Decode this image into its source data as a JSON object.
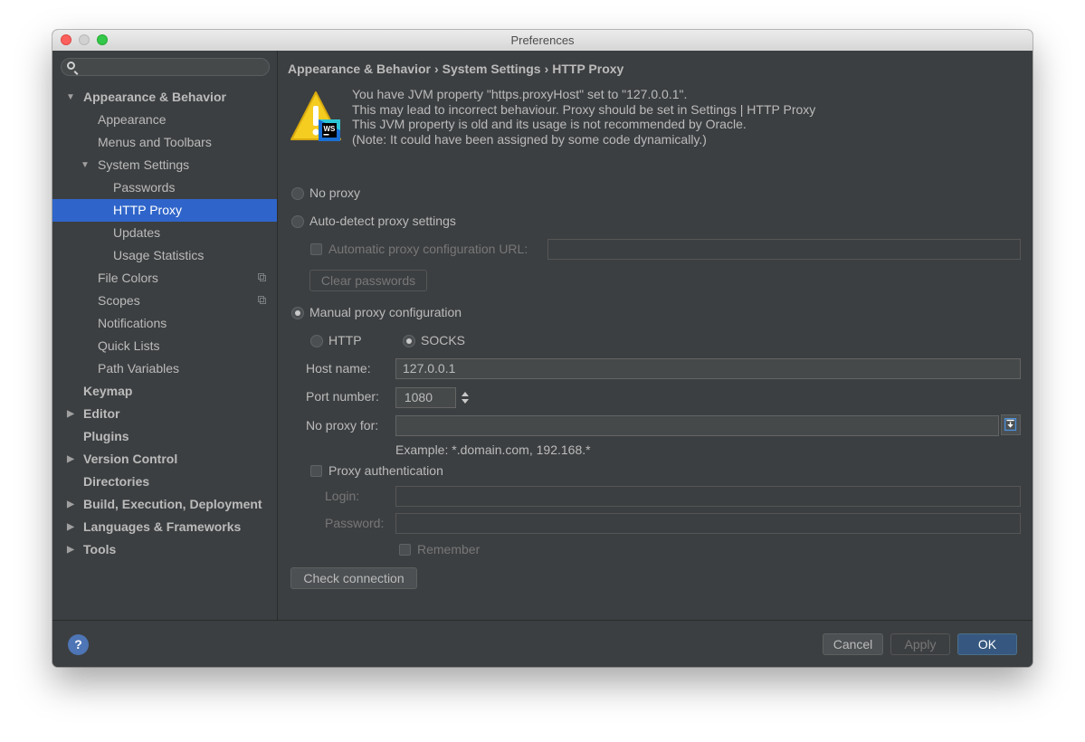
{
  "window": {
    "title": "Preferences"
  },
  "search": {
    "icon": "search-icon",
    "placeholder": ""
  },
  "sidebar": {
    "items": [
      {
        "label": "Appearance & Behavior",
        "expanded": true
      },
      {
        "label": "Appearance"
      },
      {
        "label": "Menus and Toolbars"
      },
      {
        "label": "System Settings",
        "expanded": true
      },
      {
        "label": "Passwords"
      },
      {
        "label": "HTTP Proxy",
        "selected": true
      },
      {
        "label": "Updates"
      },
      {
        "label": "Usage Statistics"
      },
      {
        "label": "File Colors"
      },
      {
        "label": "Scopes"
      },
      {
        "label": "Notifications"
      },
      {
        "label": "Quick Lists"
      },
      {
        "label": "Path Variables"
      },
      {
        "label": "Keymap"
      },
      {
        "label": "Editor",
        "collapsed": true
      },
      {
        "label": "Plugins"
      },
      {
        "label": "Version Control",
        "collapsed": true
      },
      {
        "label": "Directories"
      },
      {
        "label": "Build, Execution, Deployment",
        "collapsed": true
      },
      {
        "label": "Languages & Frameworks",
        "collapsed": true
      },
      {
        "label": "Tools",
        "collapsed": true
      }
    ]
  },
  "breadcrumb": [
    "Appearance & Behavior",
    "System Settings",
    "HTTP Proxy"
  ],
  "warning": {
    "icon": "webstorm-warning-icon",
    "lines": [
      "You have JVM property \"https.proxyHost\" set to \"127.0.0.1\".",
      "This may lead to incorrect behaviour. Proxy should be set in Settings | HTTP Proxy",
      "This JVM property is old and its usage is not recommended by Oracle.",
      "(Note: It could have been assigned by some code dynamically.)"
    ]
  },
  "proxy": {
    "no_proxy_label": "No proxy",
    "auto_detect_label": "Auto-detect proxy settings",
    "auto_config_url_label": "Automatic proxy configuration URL:",
    "auto_config_url_value": "",
    "clear_passwords_label": "Clear passwords",
    "manual_label": "Manual proxy configuration",
    "http_label": "HTTP",
    "socks_label": "SOCKS",
    "host_label": "Host name:",
    "host_value": "127.0.0.1",
    "port_label": "Port number:",
    "port_value": "1080",
    "no_proxy_for_label": "No proxy for:",
    "no_proxy_for_value": "",
    "example_text": "Example: *.domain.com, 192.168.*",
    "auth_label": "Proxy authentication",
    "login_label": "Login:",
    "login_value": "",
    "password_label": "Password:",
    "password_value": "",
    "remember_label": "Remember",
    "check_connection_label": "Check connection",
    "selected_mode": "Manual proxy configuration",
    "selected_protocol": "SOCKS"
  },
  "footer": {
    "help_label": "?",
    "cancel_label": "Cancel",
    "apply_label": "Apply",
    "ok_label": "OK"
  },
  "colors": {
    "selection": "#2f65ca",
    "background": "#3c3f41",
    "ok_button": "#365880"
  }
}
